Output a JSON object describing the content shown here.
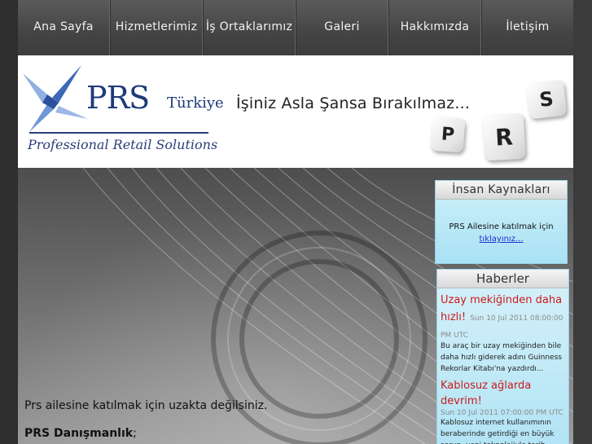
{
  "nav": {
    "items": [
      {
        "label": "Ana Sayfa"
      },
      {
        "label": "Hizmetlerimiz"
      },
      {
        "label": "İş Ortaklarımız"
      },
      {
        "label": "Galeri"
      },
      {
        "label": "Hakkımızda"
      },
      {
        "label": "İletişim"
      }
    ]
  },
  "banner": {
    "logo_prs": "PRS",
    "logo_turkiye": "Türkiye",
    "logo_subtitle": "Professional Retail Solutions",
    "tagline": "İşiniz Asla Şansa Bırakılmaz...",
    "dice": [
      "S",
      "P",
      "R"
    ]
  },
  "content": {
    "line1": "Prs ailesine katılmak için uzakta değilsiniz.",
    "line2_bold": "PRS Danışmanlık",
    "line2_rest": ";"
  },
  "hr_widget": {
    "title": "İnsan Kaynakları",
    "text": "PRS Ailesine katılmak için",
    "link": "tıklayınız..."
  },
  "news_widget": {
    "title": "Haberler",
    "items": [
      {
        "headline": "Uzay mekiğinden daha hızlı!",
        "date": "Sun 10 Jul 2011 08:00:00 PM UTC",
        "body": "Bu araç bir uzay mekiğinden bile daha hızlı giderek adını Guinness Rekorlar Kitabı'na yazdırdı..."
      },
      {
        "headline": "Kablosuz ağlarda devrim!",
        "date": "Sun 10 Jul 2011 07:00:00 PM UTC",
        "body": "Kablosuz internet kullanımının beraberinde getirdiği en büyük sorun, yeni teknolojiyle tarih olacak"
      }
    ]
  },
  "colors": {
    "nav_bg": "#444444",
    "brand_blue": "#1e3a7a",
    "news_red": "#cc1a1a",
    "widget_blue": "#b2e4f5"
  }
}
